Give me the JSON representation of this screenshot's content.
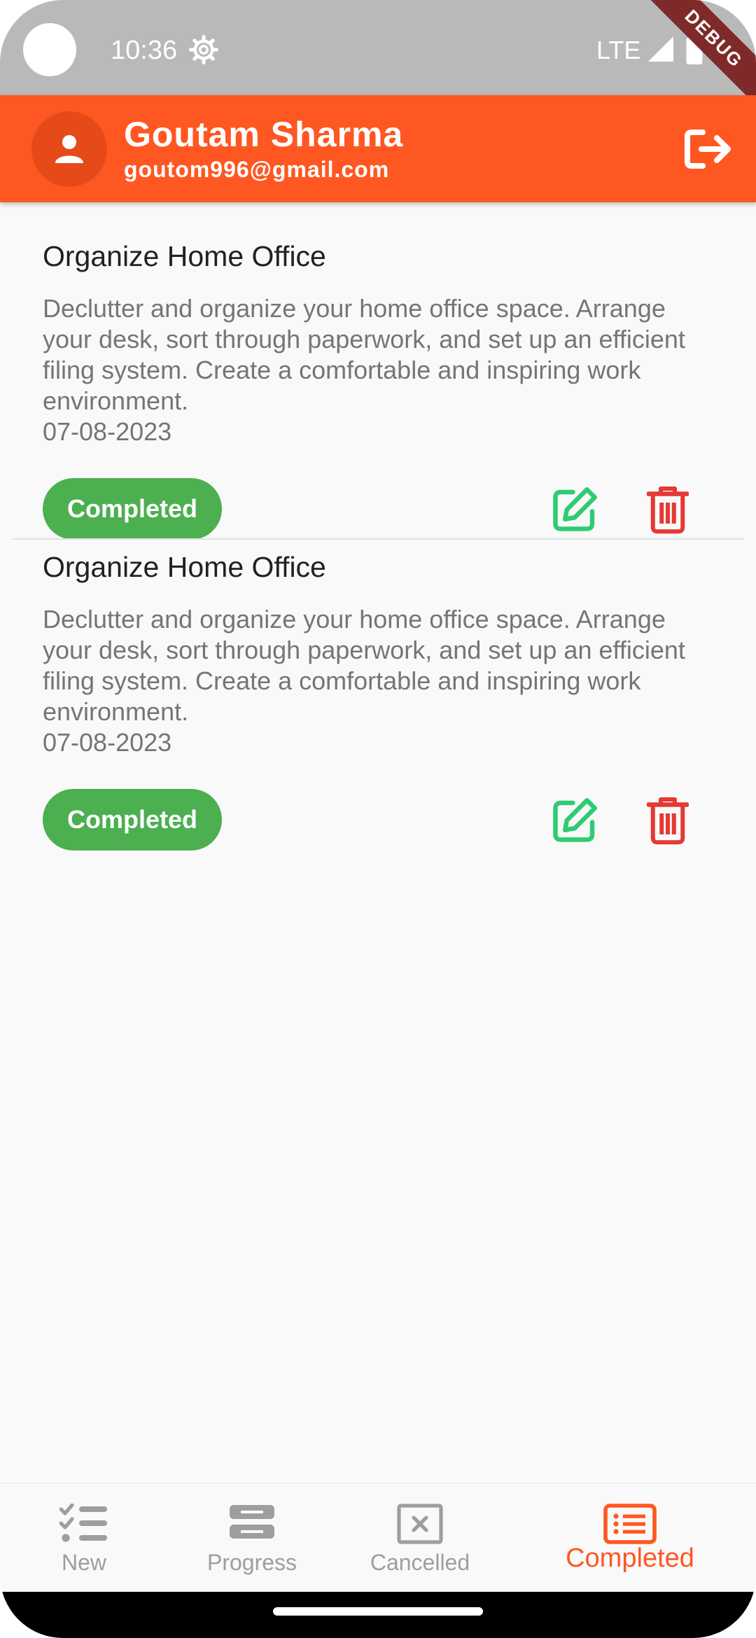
{
  "status_bar": {
    "time": "10:36",
    "network": "LTE",
    "debug_label": "DEBUG",
    "icons": [
      "settings-icon",
      "signal-icon",
      "battery-icon"
    ]
  },
  "header": {
    "user_name": "Goutam Sharma",
    "user_email": "goutom996@gmail.com",
    "avatar_icon": "person-icon",
    "logout_icon": "logout-icon",
    "background": "#ff5722"
  },
  "tasks": [
    {
      "title": "Organize Home Office",
      "description": "Declutter and organize your home office space. Arrange your desk, sort through paperwork, and set up an efficient filing system. Create a comfortable and inspiring work environment.",
      "date": "07-08-2023",
      "status": "Completed"
    },
    {
      "title": "Organize Home Office",
      "description": "Declutter and organize your home office space. Arrange your desk, sort through paperwork, and set up an efficient filing system. Create a comfortable and inspiring work environment.",
      "date": "07-08-2023",
      "status": "Completed"
    }
  ],
  "colors": {
    "status_completed": "#4caf50",
    "edit_icon": "#2ecc71",
    "delete_icon": "#e53935",
    "accent": "#ff5722",
    "inactive": "#9e9e9e"
  },
  "bottom_nav": {
    "items": [
      {
        "label": "New",
        "icon": "checklist-icon",
        "active": false
      },
      {
        "label": "Progress",
        "icon": "progress-icon",
        "active": false
      },
      {
        "label": "Cancelled",
        "icon": "cancel-box-icon",
        "active": false
      },
      {
        "label": "Completed",
        "icon": "list-icon",
        "active": true
      }
    ]
  }
}
